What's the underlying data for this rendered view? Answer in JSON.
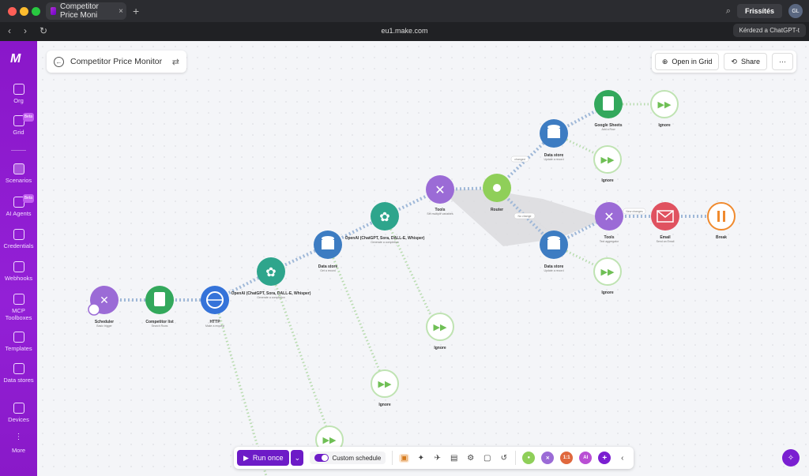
{
  "browser": {
    "tab_title": "Competitor Price Moni",
    "tab_close": "×",
    "new_tab": "+",
    "url": "eu1.make.com",
    "refresh_label": "Frissítés",
    "avatar_initials": "GL",
    "ask_label": "Kérdezd a ChatGPT-t",
    "back": "‹",
    "forward": "›",
    "reload": "↻"
  },
  "sidebar": {
    "logo": "M",
    "items": [
      {
        "label": "Org",
        "icon": "home-icon"
      },
      {
        "label": "Grid",
        "icon": "grid-icon",
        "badge": "Beta"
      },
      {
        "label": "Scenarios",
        "icon": "scenarios-icon",
        "active": true
      },
      {
        "label": "AI Agents",
        "icon": "ai-agents-icon",
        "badge": "Beta"
      },
      {
        "label": "Credentials",
        "icon": "credentials-icon"
      },
      {
        "label": "Webhooks",
        "icon": "webhooks-icon"
      },
      {
        "label": "MCP Toolboxes",
        "icon": "mcp-icon"
      },
      {
        "label": "Templates",
        "icon": "templates-icon"
      },
      {
        "label": "Data stores",
        "icon": "datastore-icon"
      },
      {
        "label": "Devices",
        "icon": "devices-icon"
      },
      {
        "label": "More",
        "icon": "more-icon"
      }
    ]
  },
  "header": {
    "title": "Competitor Price Monitor",
    "open_grid": "Open in Grid",
    "share": "Share",
    "more": "···"
  },
  "nodes": [
    {
      "label": "Scheduler",
      "sub": "Basic trigger",
      "color": "#9b6bd6"
    },
    {
      "label": "Competitor list",
      "sub": "Search Rows",
      "color": "#33a85c"
    },
    {
      "label": "HTTP",
      "sub": "Make a request",
      "color": "#3573d9"
    },
    {
      "label": "OpenAI (ChatGPT, Sora, DALL-E, Whisper)",
      "sub": "Generate a completion",
      "color": "#2ea58c"
    },
    {
      "label": "Data store",
      "sub": "Get a record",
      "color": "#3d7cc2"
    },
    {
      "label": "OpenAI (ChatGPT, Sora, DALL-E, Whisper)",
      "sub": "Generate a completion",
      "color": "#2ea58c"
    },
    {
      "label": "Tools",
      "sub": "Set multiple variables",
      "color": "#9b6bd6"
    },
    {
      "label": "Router",
      "sub": "",
      "color": "#8fcf59"
    },
    {
      "label": "Data store",
      "sub": "Update a record",
      "color": "#3d7cc2"
    },
    {
      "label": "Google Sheets",
      "sub": "Add a Row",
      "color": "#33a85c"
    },
    {
      "label": "Data store",
      "sub": "Update a record",
      "color": "#3d7cc2"
    },
    {
      "label": "Tools",
      "sub": "Text aggregator",
      "color": "#9b6bd6"
    },
    {
      "label": "Email",
      "sub": "Send an Email",
      "color": "#e05260"
    },
    {
      "label": "Break",
      "sub": "",
      "color": "#f08a2e"
    }
  ],
  "ignore_label": "Ignore",
  "route_labels": {
    "changed": "changed",
    "no_change": "No change",
    "new_changes": "New changes"
  },
  "toolbar": {
    "run_once": "Run once",
    "custom_schedule": "Custom schedule",
    "chip_ai": "AI",
    "chip_11": "1:1"
  }
}
